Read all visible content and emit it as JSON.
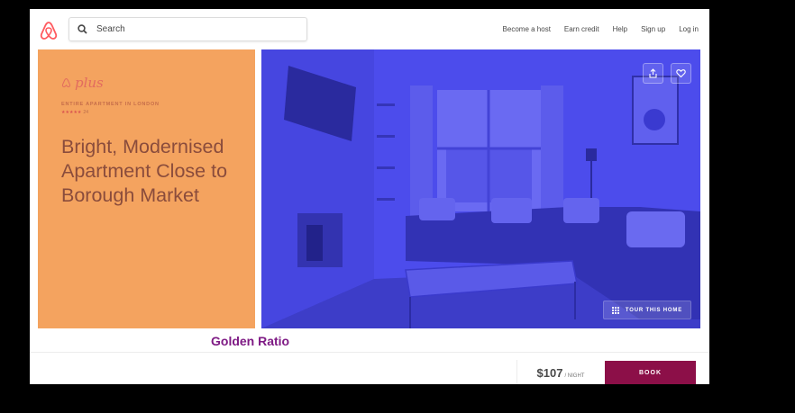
{
  "header": {
    "search_placeholder": "Search",
    "nav": [
      "Become a host",
      "Earn credit",
      "Help",
      "Sign up",
      "Log in"
    ]
  },
  "listing": {
    "brand_label": "plus",
    "eyebrow": "ENTIRE APARTMENT IN LONDON",
    "stars": "★★★★★",
    "review_count": "24",
    "title": "Bright, Modernised Apartment Close to Borough Market"
  },
  "photo": {
    "tour_label": "TOUR THIS HOME",
    "icons": [
      "share-icon",
      "heart-icon",
      "grid-icon"
    ]
  },
  "annotation": "Golden Ratio",
  "booking": {
    "price": "$107",
    "per_label": "/ NIGHT",
    "book_label": "BOOK"
  },
  "colors": {
    "panel": "#f4a35f",
    "photo_overlay": "#4c4cec",
    "book_button": "#8c0f48",
    "annotation": "#7e1a84",
    "airbnb_brand": "#ff5a5f"
  }
}
